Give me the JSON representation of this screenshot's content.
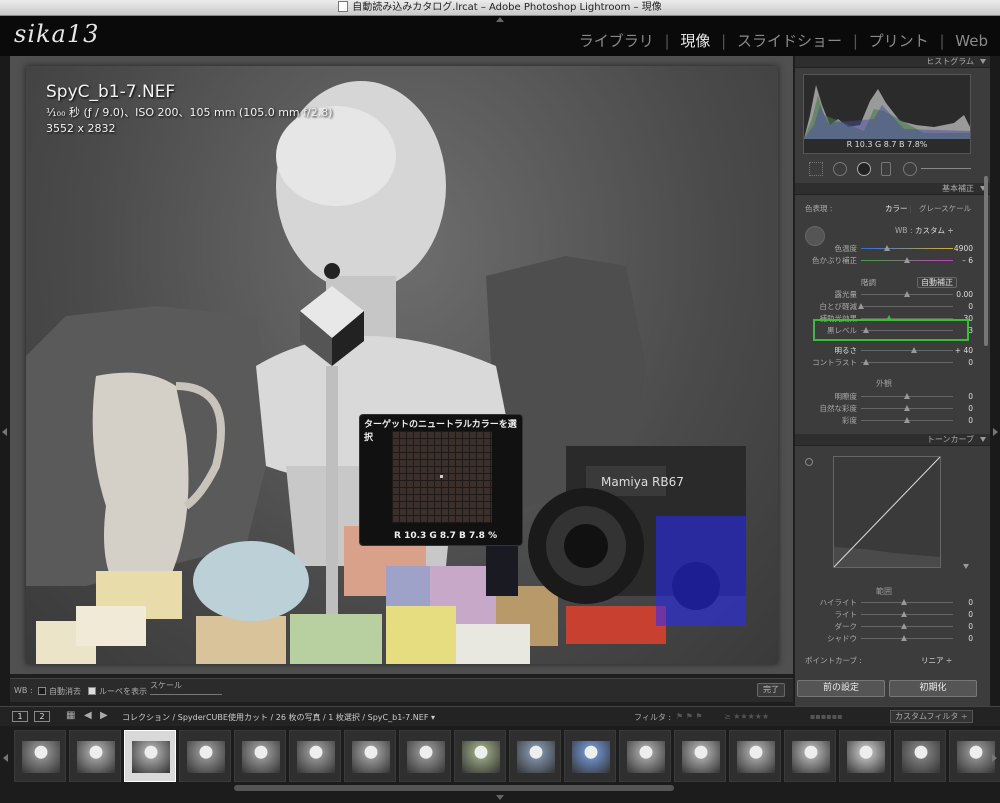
{
  "window": {
    "title": "自動読み込みカタログ.lrcat – Adobe Photoshop Lightroom – 現像"
  },
  "identity": {
    "logo": "sika13"
  },
  "modules": [
    {
      "label": "ライブラリ",
      "active": false
    },
    {
      "label": "現像",
      "active": true
    },
    {
      "label": "スライドショー",
      "active": false
    },
    {
      "label": "プリント",
      "active": false
    },
    {
      "label": "Web",
      "active": false
    }
  ],
  "photo_info": {
    "filename": "SpyC_b1-7.NEF",
    "exif": "¹⁄₁₀₀ 秒 (ƒ / 9.0)、ISO 200、105 mm (105.0 mm f/2.8)",
    "dimensions": "3552 x 2832"
  },
  "loupe": {
    "title": "ターゲットのニュートラルカラーを選択",
    "readout": "R 10.3  G 8.7   B 7.8   %"
  },
  "toolbar": {
    "wb_label": "WB :",
    "auto_dismiss": "自動消去",
    "show_loupe": "ルーペを表示",
    "scale": "スケール",
    "done": "完了"
  },
  "histogram": {
    "title": "ヒストグラム",
    "readout": "R  10.3  G  8.7  B  7.8%"
  },
  "basic": {
    "title": "基本補正",
    "treatment_label": "色表現 :",
    "color": "カラー",
    "grayscale": "グレースケール",
    "wb_label": "WB :",
    "wb_value": "カスタム ÷",
    "temp_label": "色温度",
    "temp_value": "4900",
    "tint_label": "色かぶり補正",
    "tint_value": "– 6",
    "tone_label": "階調",
    "auto_tone": "自動補正",
    "exposure_label": "露光量",
    "exposure_value": "0.00",
    "recovery_label": "白とび軽減",
    "recovery_value": "0",
    "fill_label": "補助光効果",
    "fill_value": "30",
    "blacks_label": "黒レベル",
    "blacks_value": "3",
    "brightness_label": "明るさ",
    "brightness_value": "+ 40",
    "contrast_label": "コントラスト",
    "contrast_value": "0",
    "presence_label": "外観",
    "clarity_label": "明瞭度",
    "clarity_value": "0",
    "vibrance_label": "自然な彩度",
    "vibrance_value": "0",
    "saturation_label": "彩度",
    "saturation_value": "0"
  },
  "tone_curve": {
    "title": "トーンカーブ",
    "region_label": "範囲",
    "highlights_label": "ハイライト",
    "highlights_value": "0",
    "lights_label": "ライト",
    "lights_value": "0",
    "darks_label": "ダーク",
    "darks_value": "0",
    "shadows_label": "シャドウ",
    "shadows_value": "0",
    "point_curve_label": "ポイントカーブ :",
    "point_curve_value": "リニア ÷"
  },
  "right_buttons": {
    "previous": "前の設定",
    "reset": "初期化"
  },
  "filmstrip_bar": {
    "page1": "1",
    "page2": "2",
    "path": "コレクション / SpyderCUBE使用カット / 26 枚の写真 / 1 枚選択 / SpyC_b1-7.NEF ▾",
    "filter_label": "フィルタ :",
    "custom_filter": "カスタムフィルタ ÷"
  },
  "filmstrip": {
    "count": 18,
    "selected_index": 2
  },
  "colors": {
    "highlight_box": "#3dbb3d",
    "shadow_clip": "#2a2aff",
    "accent_text": "#e8e8e8"
  }
}
